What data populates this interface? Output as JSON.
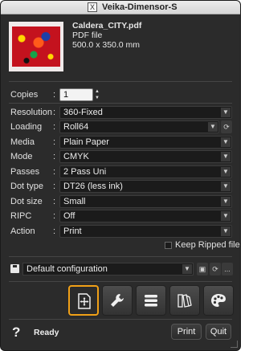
{
  "window": {
    "title": "Veika-Dimensor-S",
    "title_icon": "X"
  },
  "file": {
    "name": "Caldera_CITY.pdf",
    "type": "PDF file",
    "size": "500.0 x 350.0 mm"
  },
  "settings": {
    "copies": {
      "label": "Copies",
      "value": "1"
    },
    "resolution": {
      "label": "Resolution",
      "value": "360-Fixed"
    },
    "loading": {
      "label": "Loading",
      "value": "Roll64"
    },
    "media": {
      "label": "Media",
      "value": "Plain Paper"
    },
    "mode": {
      "label": "Mode",
      "value": "CMYK"
    },
    "passes": {
      "label": "Passes",
      "value": "2 Pass Uni"
    },
    "dot_type": {
      "label": "Dot type",
      "value": "DT26 (less ink)"
    },
    "dot_size": {
      "label": "Dot size",
      "value": "Small"
    },
    "ripc": {
      "label": "RIPC",
      "value": "Off"
    },
    "action": {
      "label": "Action",
      "value": "Print"
    }
  },
  "colon": ":",
  "keep_ripped": {
    "label": "Keep Ripped file",
    "checked": false
  },
  "configuration": {
    "value": "Default configuration",
    "more_label": "..."
  },
  "toolbar": {
    "tools": [
      {
        "icon": "placement-icon",
        "active": true
      },
      {
        "icon": "wrench-icon",
        "active": false
      },
      {
        "icon": "list-icon",
        "active": false
      },
      {
        "icon": "swatch-icon",
        "active": false
      },
      {
        "icon": "palette-icon",
        "active": false
      }
    ],
    "accent": "#f0a017"
  },
  "footer": {
    "help": "?",
    "status": "Ready",
    "print_label": "Print",
    "quit_label": "Quit"
  }
}
